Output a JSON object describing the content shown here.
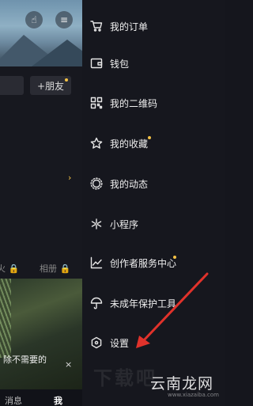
{
  "left_page": {
    "add_friend_label": "+朋友",
    "lock_tab_1": "火 🔒",
    "lock_tab_2": "相册 🔒",
    "toast_line_1": "除不需要的",
    "toast_line_2": "",
    "nav_messages": "消息",
    "nav_me": "我",
    "close_glyph": "×",
    "chevron": "›"
  },
  "drawer": {
    "items": [
      {
        "label": "我的订单",
        "icon": "cart-icon",
        "dot": false
      },
      {
        "label": "钱包",
        "icon": "wallet-icon",
        "dot": false
      },
      {
        "label": "我的二维码",
        "icon": "qr-code-icon",
        "dot": false
      },
      {
        "label": "我的收藏",
        "icon": "star-icon",
        "dot": true
      },
      {
        "label": "我的动态",
        "icon": "sun-icon",
        "dot": false
      },
      {
        "label": "小程序",
        "icon": "asterisk-icon",
        "dot": false
      },
      {
        "label": "创作者服务中心",
        "icon": "chart-line-icon",
        "dot": true
      },
      {
        "label": "未成年保护工具",
        "icon": "umbrella-icon",
        "dot": false
      },
      {
        "label": "设置",
        "icon": "hexagon-settings-icon",
        "dot": false
      }
    ]
  },
  "annotation": {
    "arrow_color": "#e0322b"
  },
  "watermark": {
    "brand": "云南龙网",
    "url": "www.xiazaiba.com"
  },
  "colors": {
    "accent_dot": "#f5c245",
    "background": "#16171e"
  }
}
